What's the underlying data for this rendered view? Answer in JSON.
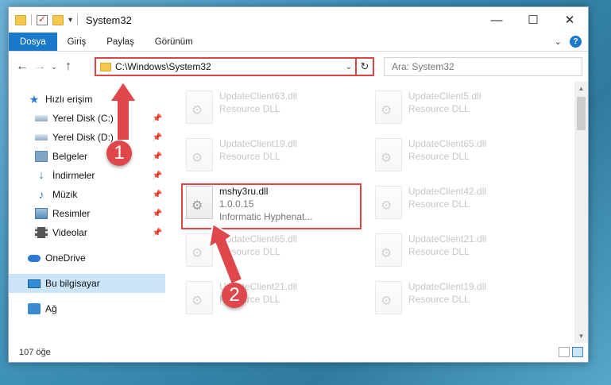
{
  "window": {
    "title": "System32",
    "controls": {
      "minimize": "—",
      "maximize": "☐",
      "close": "✕"
    }
  },
  "ribbon": {
    "tabs": [
      "Dosya",
      "Giriş",
      "Paylaş",
      "Görünüm"
    ]
  },
  "address": {
    "path": "C:\\Windows\\System32",
    "search_placeholder": "Ara: System32"
  },
  "sidebar": {
    "items": [
      {
        "label": "Hızlı erişim",
        "icon": "star-icon"
      },
      {
        "label": "Yerel Disk (C:)",
        "icon": "drive-icon",
        "pinned": true
      },
      {
        "label": "Yerel Disk (D:)",
        "icon": "drive-icon",
        "pinned": true
      },
      {
        "label": "Belgeler",
        "icon": "documents-icon",
        "pinned": true
      },
      {
        "label": "İndirmeler",
        "icon": "download-icon",
        "pinned": true
      },
      {
        "label": "Müzik",
        "icon": "music-icon",
        "pinned": true
      },
      {
        "label": "Resimler",
        "icon": "pictures-icon",
        "pinned": true
      },
      {
        "label": "Videolar",
        "icon": "videos-icon",
        "pinned": true
      },
      {
        "label": "OneDrive",
        "icon": "onedrive-icon"
      },
      {
        "label": "Bu bilgisayar",
        "icon": "this-pc-icon",
        "selected": true
      },
      {
        "label": "Ağ",
        "icon": "network-icon"
      }
    ]
  },
  "files": [
    {
      "name": "UpdateClient63.dll",
      "sub": "Resource DLL"
    },
    {
      "name": "UpdateClient5.dll",
      "sub": "Resource DLL"
    },
    {
      "name": "UpdateClient19.dll",
      "sub": "Resource DLL"
    },
    {
      "name": "UpdateClient65.dll",
      "sub": "Resource DLL"
    },
    {
      "name": "mshy3ru.dll",
      "sub": "1.0.0.15",
      "sub2": "Informatic Hyphenat..."
    },
    {
      "name": "UpdateClient42.dll",
      "sub": "Resource DLL"
    },
    {
      "name": "UpdateClient65.dll",
      "sub": "Resource DLL"
    },
    {
      "name": "UpdateClient21.dll",
      "sub": "Resource DLL"
    },
    {
      "name": "UpdateClient21.dll",
      "sub": "Resource DLL"
    },
    {
      "name": "UpdateClient19.dll",
      "sub": "Resource DLL"
    }
  ],
  "status": {
    "count": "107 öğe"
  },
  "callouts": [
    "1",
    "2"
  ],
  "colors": {
    "accent": "#1979ca",
    "highlight": "#e04343",
    "selection": "#cce4f7"
  }
}
